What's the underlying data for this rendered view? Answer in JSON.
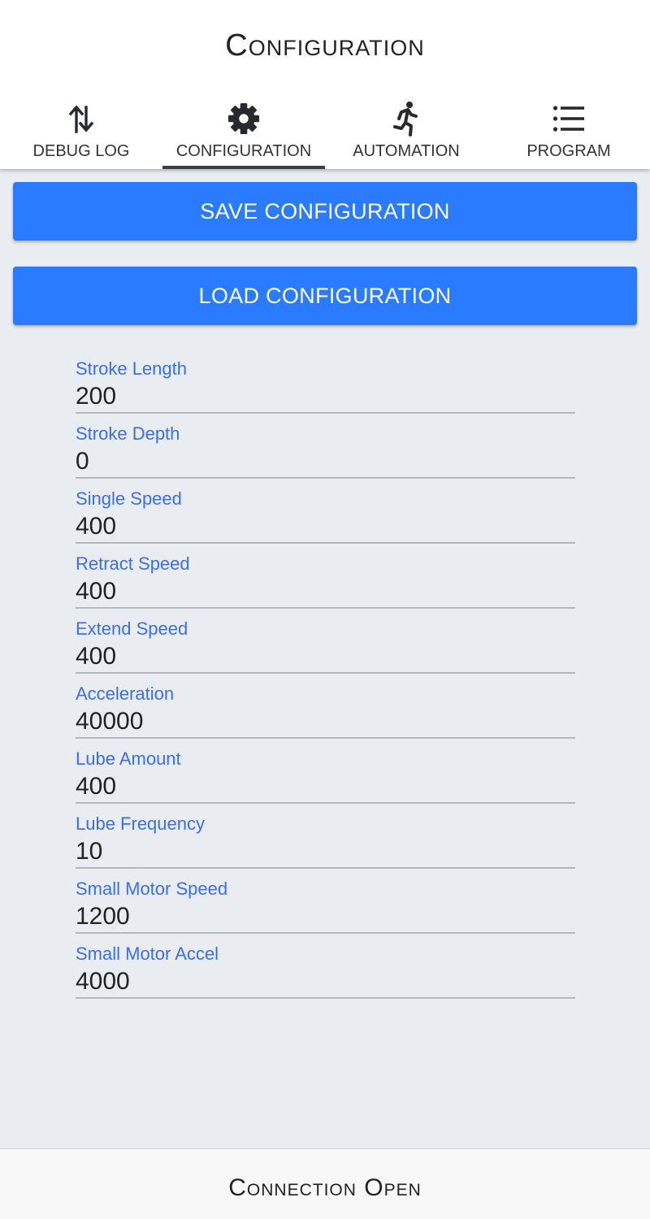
{
  "header": {
    "title": "Configuration",
    "tabs": [
      {
        "label": "DEBUG LOG",
        "icon": "swap-vertical-icon"
      },
      {
        "label": "CONFIGURATION",
        "icon": "gear-icon",
        "active": true
      },
      {
        "label": "AUTOMATION",
        "icon": "running-person-icon"
      },
      {
        "label": "PROGRAM",
        "icon": "list-icon"
      }
    ]
  },
  "actions": {
    "save_label": "SAVE CONFIGURATION",
    "load_label": "LOAD CONFIGURATION"
  },
  "fields": [
    {
      "label": "Stroke Length",
      "value": "200"
    },
    {
      "label": "Stroke Depth",
      "value": "0"
    },
    {
      "label": "Single Speed",
      "value": "400"
    },
    {
      "label": "Retract Speed",
      "value": "400"
    },
    {
      "label": "Extend Speed",
      "value": "400"
    },
    {
      "label": "Acceleration",
      "value": "40000"
    },
    {
      "label": "Lube Amount",
      "value": "400"
    },
    {
      "label": "Lube Frequency",
      "value": "10"
    },
    {
      "label": "Small Motor Speed",
      "value": "1200"
    },
    {
      "label": "Small Motor Accel",
      "value": "4000"
    }
  ],
  "footer": {
    "status": "Connection Open"
  },
  "colors": {
    "accent": "#2a7bff",
    "label": "#3b6fe6",
    "background": "#e9ecf0",
    "tab_indicator": "#3a3f4b"
  }
}
